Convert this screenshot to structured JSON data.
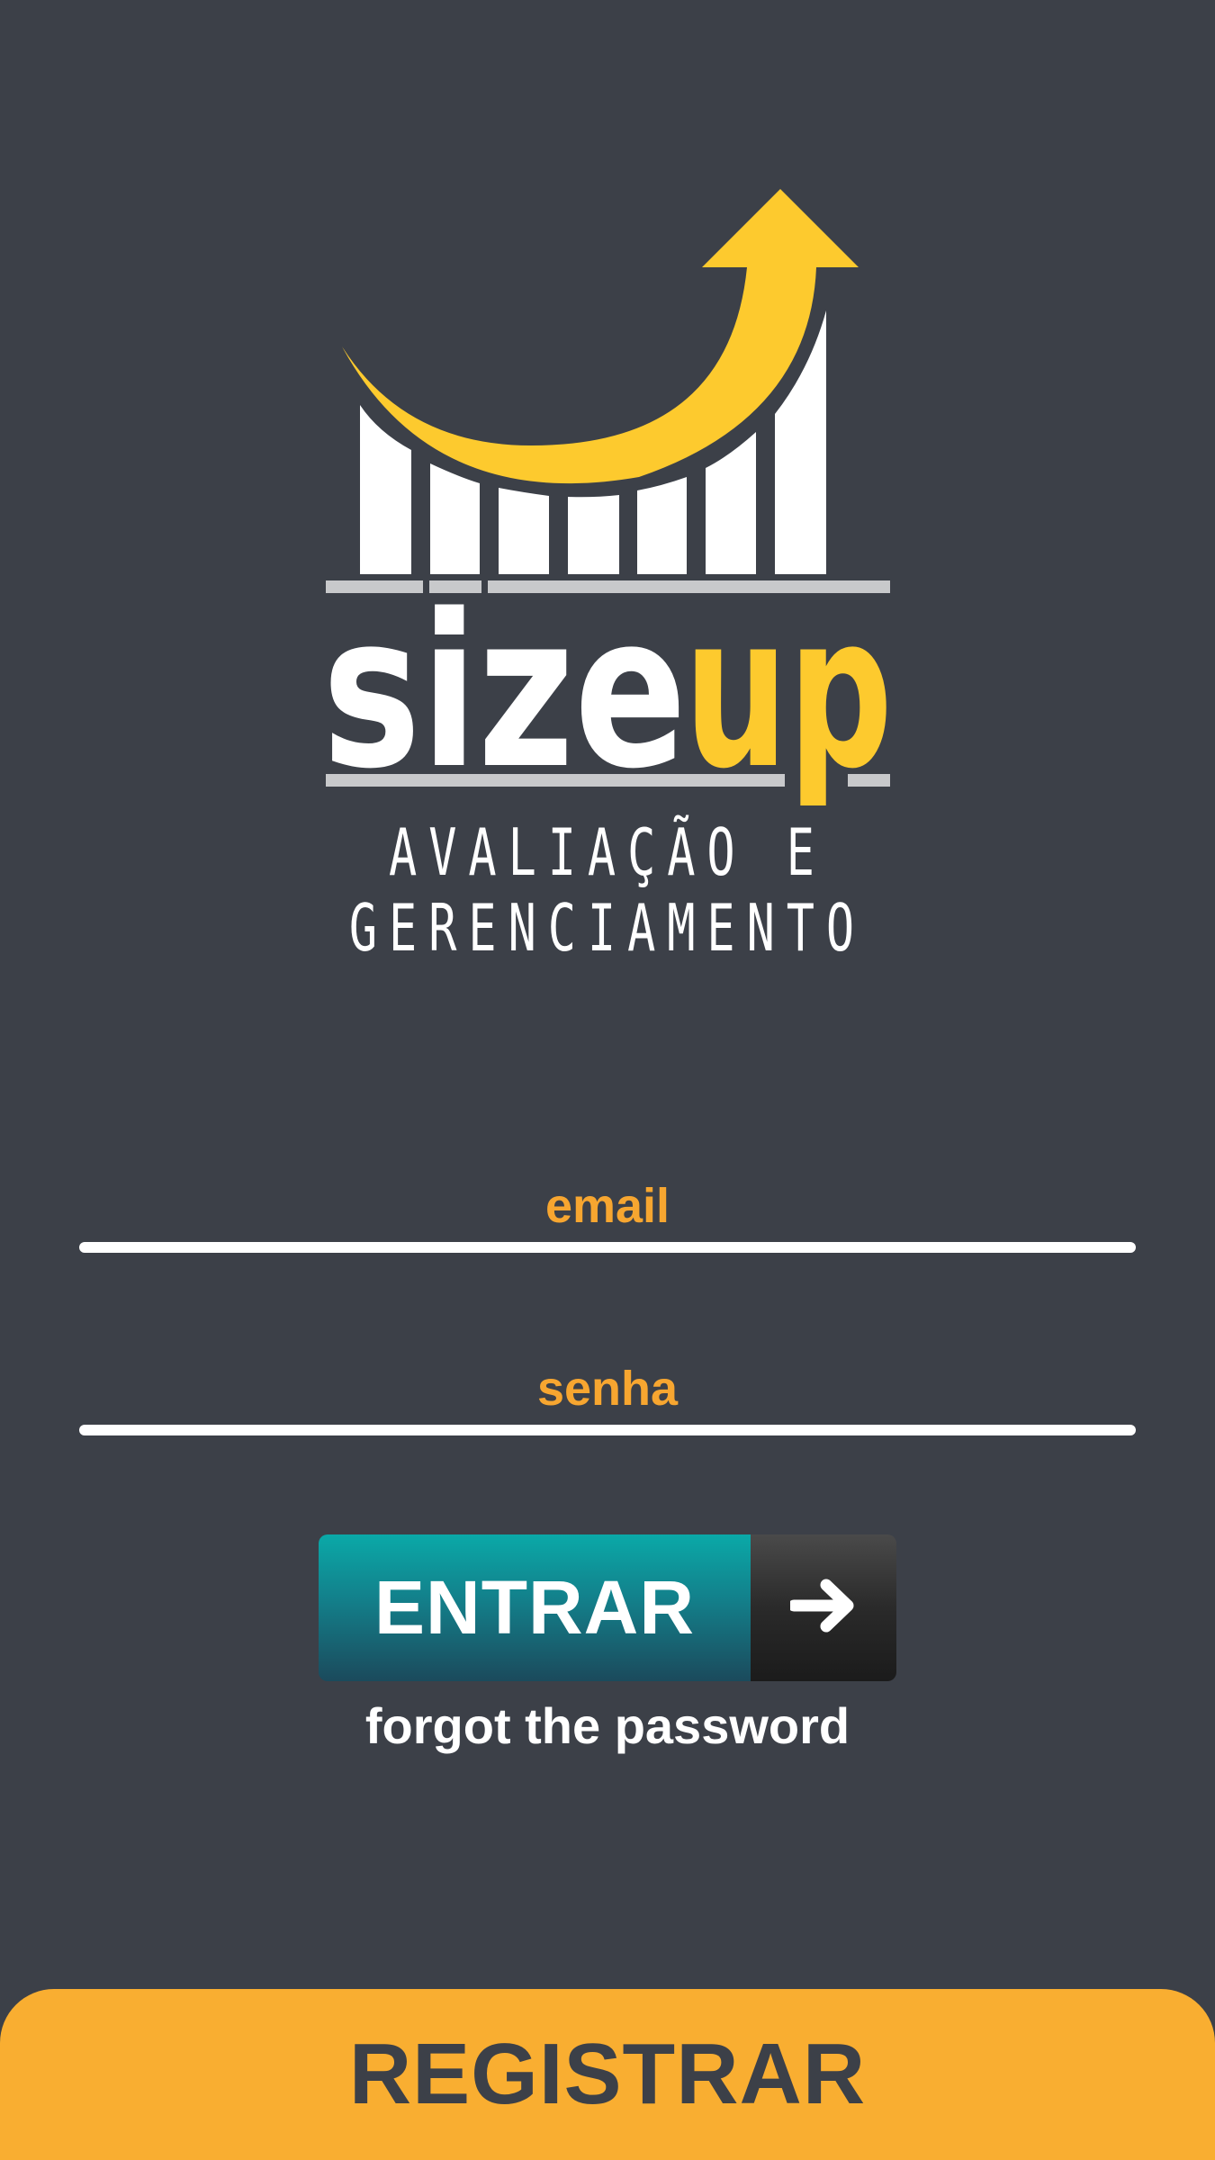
{
  "logo": {
    "wordmark_left": "size",
    "wordmark_right": "up",
    "tagline": "AVALIAÇÃO E GERENCIAMENTO",
    "colors": {
      "yellow": "#fdca2e",
      "white": "#ffffff",
      "gray": "#c8c9cb"
    }
  },
  "form": {
    "email_label": "email",
    "senha_label": "senha",
    "email_value": "",
    "senha_value": ""
  },
  "actions": {
    "entrar_label": "ENTRAR",
    "entrar_icon": "arrow-right-icon",
    "forgot_label": "forgot the password",
    "registrar_label": "REGISTRAR"
  },
  "theme": {
    "background": "#3c4048",
    "accent_orange": "#f7a630",
    "button_teal": "#0aa9a8",
    "registrar_bg": "#f9ae31"
  }
}
